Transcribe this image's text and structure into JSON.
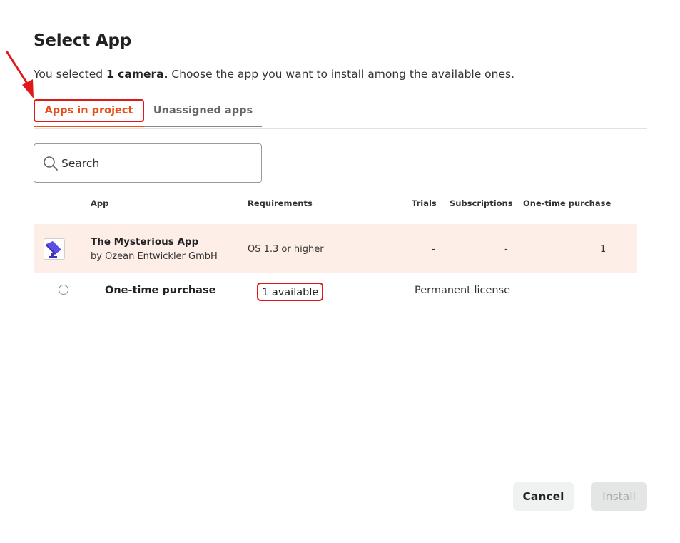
{
  "dialog": {
    "title": "Select App",
    "subtitle_prefix": "You selected ",
    "subtitle_bold": "1 camera.",
    "subtitle_suffix": " Choose the app you want to install among the available ones."
  },
  "tabs": [
    {
      "label": "Apps in project",
      "active": true
    },
    {
      "label": "Unassigned apps",
      "active": false
    }
  ],
  "search": {
    "placeholder": "Search",
    "value": ""
  },
  "table": {
    "headers": {
      "app": "App",
      "requirements": "Requirements",
      "trials": "Trials",
      "subscriptions": "Subscriptions",
      "one_time": "One-time purchase"
    },
    "app_row": {
      "icon": "camera-app-icon",
      "name": "The Mysterious App",
      "vendor": "by Ozean Entwickler GmbH",
      "requirements": "OS 1.3 or higher",
      "trials": "-",
      "subscriptions": "-",
      "one_time": "1"
    },
    "license_row": {
      "name": "One-time purchase",
      "availability": "1 available",
      "type": "Permanent license",
      "selected": false
    }
  },
  "buttons": {
    "cancel": "Cancel",
    "install": "Install"
  },
  "colors": {
    "accent": "#e8501a",
    "annotation_red": "#e01818",
    "app_row_bg": "#fdeee8",
    "icon_purple": "#5a4ee8"
  }
}
